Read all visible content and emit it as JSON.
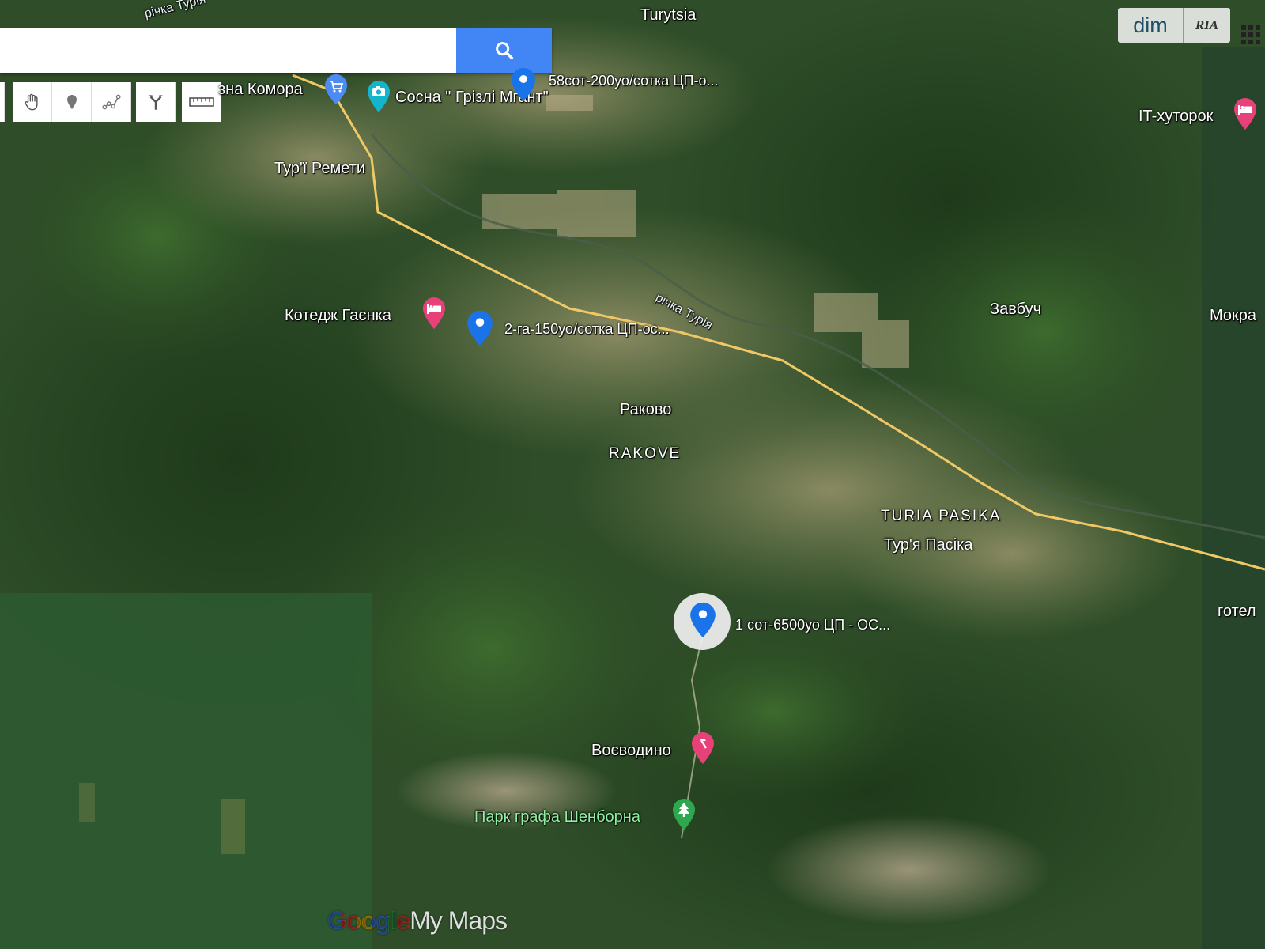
{
  "search": {
    "value": "",
    "placeholder": ""
  },
  "toolbar": {
    "items": [
      "hand-tool",
      "add-marker",
      "draw-line",
      "directions",
      "measure-ruler"
    ]
  },
  "brand": {
    "google": "Google",
    "mymaps": "My Maps"
  },
  "partner": {
    "dim": "dim",
    "ria": "RIA"
  },
  "places": {
    "turytsia": "Turytsia",
    "turi_remety": "Тур'ї Ремети",
    "rakovo": "Раково",
    "rakove": "RAKOVE",
    "turia_pasika_en": "TURIA PASIKA",
    "turia_pasika_ua": "Тур'я Пасіка",
    "zavbuch": "Завбуч",
    "mokra": "Мокра",
    "voievodyno": "Воєводино"
  },
  "rivers": {
    "top": "річка Турія",
    "middle": "річка Турія"
  },
  "pois": {
    "komora": "зна Комора",
    "sosna": "Сосна \" Грізлі Мгант\"",
    "kotedzh": "Котедж Гаєнка",
    "it_khutorok": "IT-хуторок",
    "park": "Парк графа Шенборна",
    "hotel": "готел"
  },
  "markers": {
    "m1": "58сот-200уо/сотка ЦП-о...",
    "m2": "2-га-150уо/сотка ЦП-ос...",
    "m3": "1 сот-6500уо ЦП - ОС..."
  },
  "colors": {
    "road": "#f0c866",
    "marker_blue": "#1a73e8",
    "hotel_pink": "#e8417a",
    "park_green": "#2ea84f",
    "search_blue": "#4285f4"
  }
}
